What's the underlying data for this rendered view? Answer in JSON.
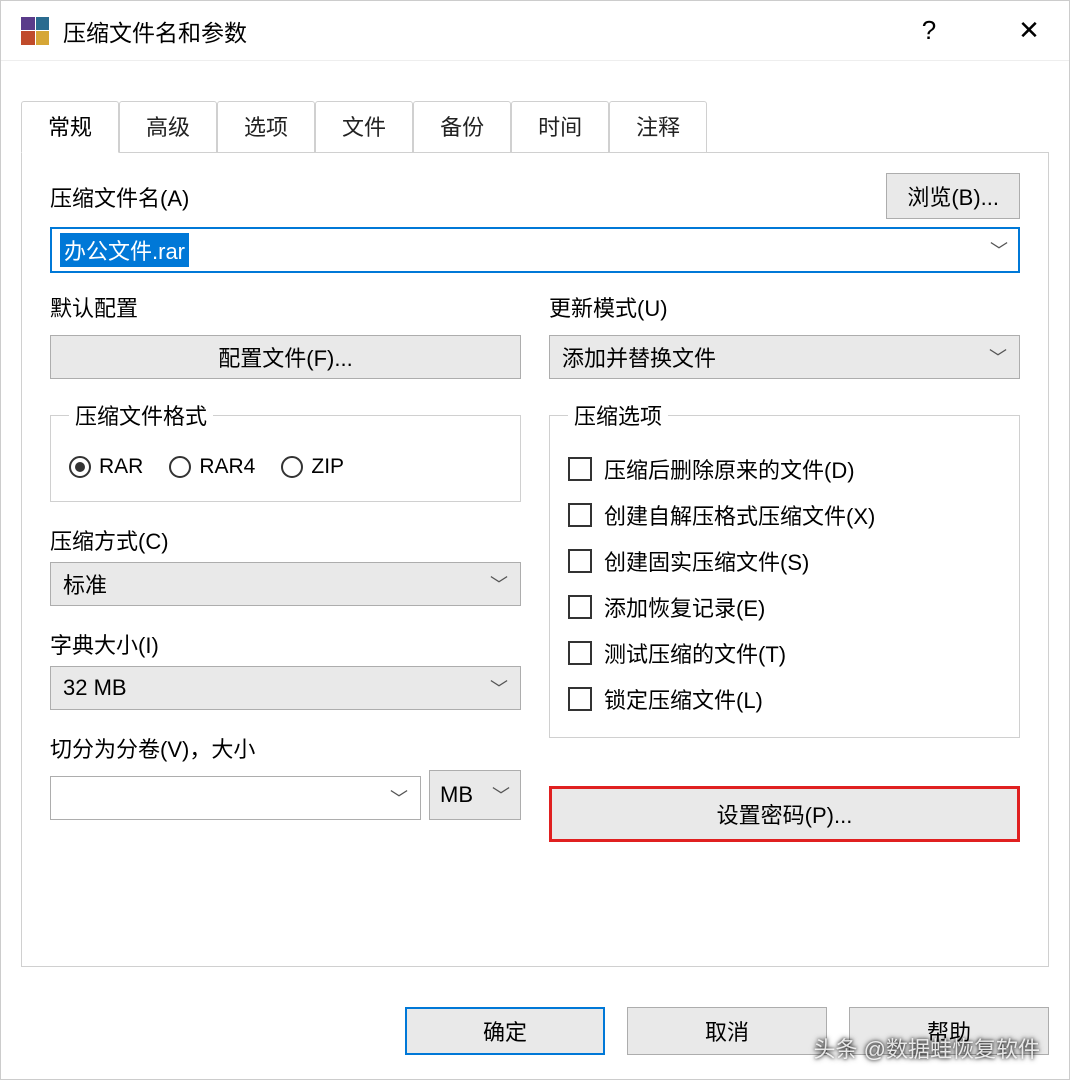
{
  "title": "压缩文件名和参数",
  "help_icon": "?",
  "close_icon": "✕",
  "tabs": [
    "常规",
    "高级",
    "选项",
    "文件",
    "备份",
    "时间",
    "注释"
  ],
  "active_tab": 0,
  "archive_name_label": "压缩文件名(A)",
  "browse_label": "浏览(B)...",
  "archive_name_value": "办公文件.rar",
  "default_profile_label": "默认配置",
  "profile_button": "配置文件(F)...",
  "update_mode_label": "更新模式(U)",
  "update_mode_value": "添加并替换文件",
  "format_group": "压缩文件格式",
  "formats": [
    "RAR",
    "RAR4",
    "ZIP"
  ],
  "format_selected": 0,
  "options_group": "压缩选项",
  "options": [
    "压缩后删除原来的文件(D)",
    "创建自解压格式压缩文件(X)",
    "创建固实压缩文件(S)",
    "添加恢复记录(E)",
    "测试压缩的文件(T)",
    "锁定压缩文件(L)"
  ],
  "method_label": "压缩方式(C)",
  "method_value": "标准",
  "dict_label": "字典大小(I)",
  "dict_value": "32 MB",
  "split_label": "切分为分卷(V)，大小",
  "split_value": "",
  "split_unit": "MB",
  "password_button": "设置密码(P)...",
  "ok": "确定",
  "cancel": "取消",
  "help": "帮助",
  "watermark": "头条 @数据蛙恢复软件"
}
